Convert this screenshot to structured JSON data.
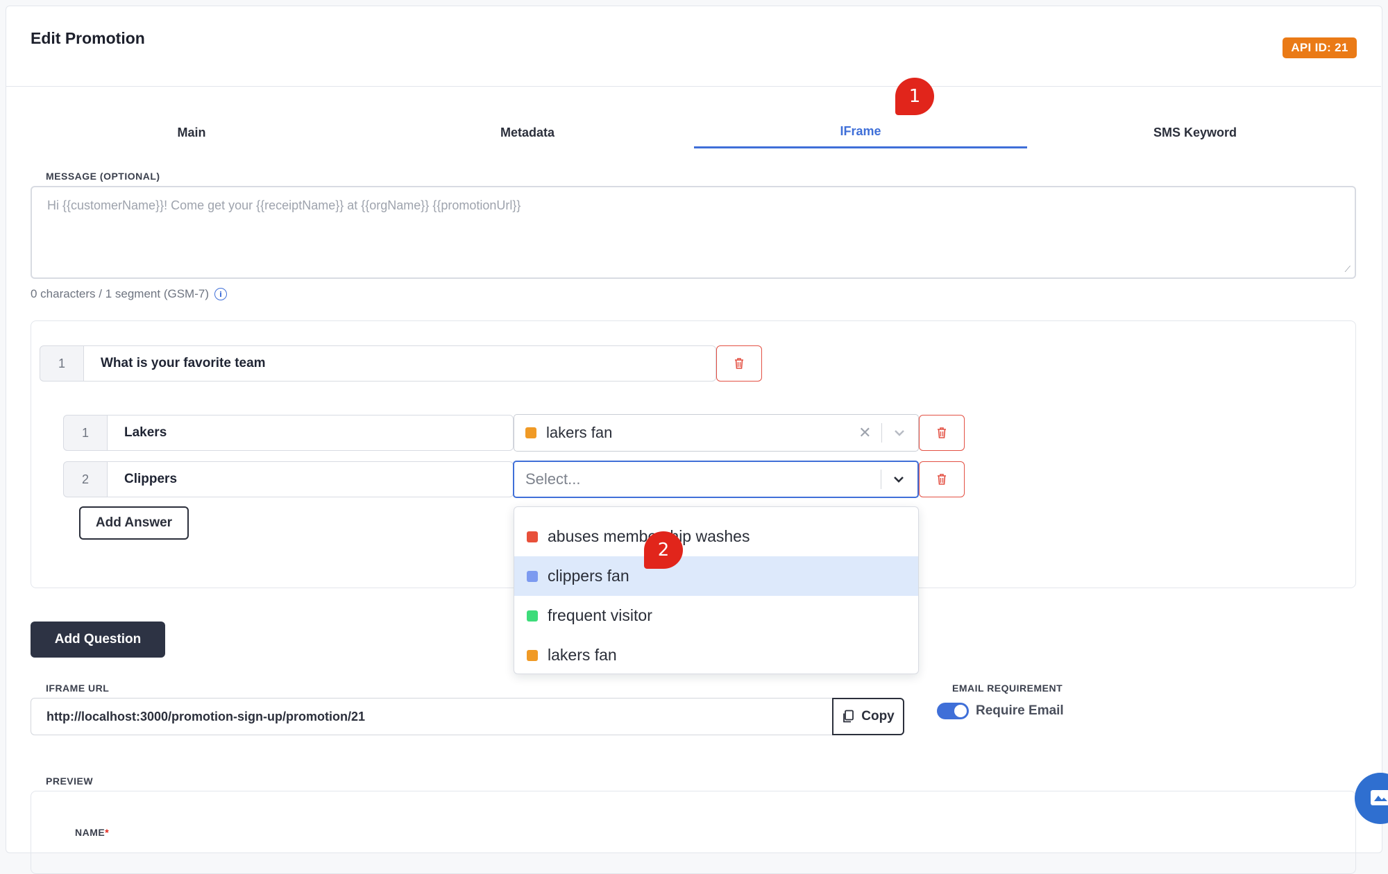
{
  "page": {
    "title": "Edit Promotion",
    "api_badge": "API ID: 21"
  },
  "tabs": [
    {
      "label": "Main",
      "active": false
    },
    {
      "label": "Metadata",
      "active": false
    },
    {
      "label": "IFrame",
      "active": true
    },
    {
      "label": "SMS Keyword",
      "active": false
    }
  ],
  "markers": {
    "first": "1",
    "second": "2"
  },
  "message": {
    "label": "MESSAGE (OPTIONAL)",
    "placeholder": "Hi {{customerName}}! Come get your {{receiptName}} at {{orgName}} {{promotionUrl}}",
    "char_count": "0 characters / 1 segment (GSM-7)",
    "info_icon": "info-icon"
  },
  "question": {
    "number": "1",
    "text": "What is your favorite team",
    "delete_icon": "trash-icon"
  },
  "answers": [
    {
      "number": "1",
      "text": "Lakers",
      "tag": "lakers fan",
      "tag_color": "#f09a26",
      "has_value": true
    },
    {
      "number": "2",
      "text": "Clippers",
      "tag": "",
      "placeholder": "Select...",
      "has_value": false
    }
  ],
  "add_answer_label": "Add Answer",
  "add_question_label": "Add Question",
  "dropdown_options": [
    {
      "label": "abuses membership washes",
      "color": "#e8503a",
      "highlighted": false
    },
    {
      "label": "clippers fan",
      "color": "#7c9af0",
      "highlighted": true
    },
    {
      "label": "frequent visitor",
      "color": "#3ddc7a",
      "highlighted": false
    },
    {
      "label": "lakers fan",
      "color": "#f09a26",
      "highlighted": false
    }
  ],
  "iframe": {
    "label": "IFRAME URL",
    "url": "http://localhost:3000/promotion-sign-up/promotion/21",
    "copy_label": "Copy",
    "copy_icon": "copy-icon"
  },
  "email": {
    "label": "EMAIL REQUIREMENT",
    "toggle_label": "Require Email",
    "enabled": true
  },
  "preview": {
    "label": "PREVIEW",
    "name_label": "NAME",
    "required_mark": "*"
  },
  "colors": {
    "accent": "#3f6fd8",
    "badge": "#ea7a16",
    "danger": "#e35043",
    "dark_button": "#2d3344",
    "marker": "#e1251b"
  }
}
